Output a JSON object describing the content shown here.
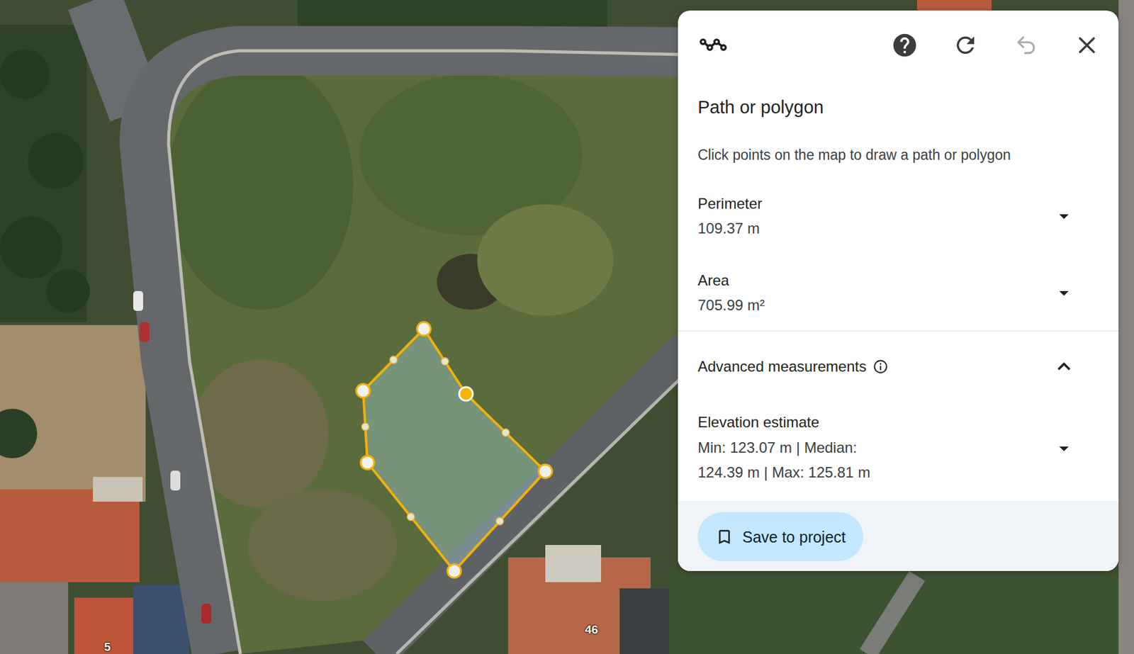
{
  "panel": {
    "title": "Path or polygon",
    "instruction": "Click points on the map to draw a path or polygon",
    "undo_disabled": true
  },
  "measurements": [
    {
      "label": "Perimeter",
      "value": "109.37 m"
    },
    {
      "label": "Area",
      "value": "705.99 m²"
    }
  ],
  "advanced": {
    "label": "Advanced measurements",
    "expanded": true,
    "items": [
      {
        "label": "Elevation estimate",
        "value": "Min: 123.07 m | Median: 124.39 m | Max: 125.81 m"
      }
    ]
  },
  "save_button": "Save to project",
  "map": {
    "labels": [
      "46",
      "5"
    ],
    "polygon": {
      "vertices": [
        {
          "selected": false
        },
        {
          "selected": true
        },
        {
          "selected": false
        },
        {
          "selected": false
        },
        {
          "selected": false
        },
        {
          "selected": false
        }
      ]
    }
  }
}
